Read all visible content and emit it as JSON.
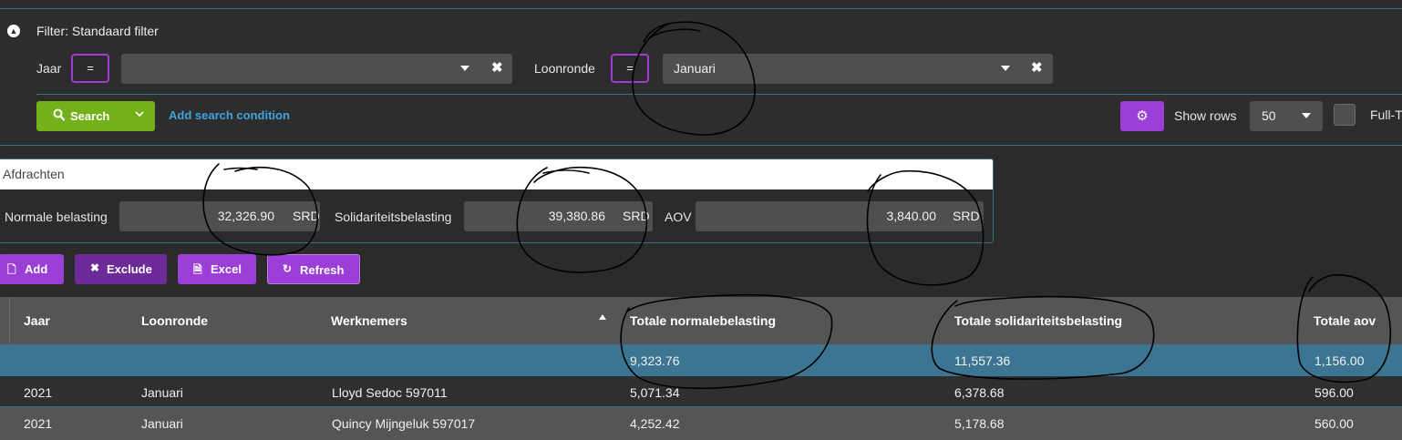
{
  "filter": {
    "title": "Filter: Standaard filter",
    "jaar_label": "Jaar",
    "jaar_operator": "=",
    "jaar_value": "",
    "loonronde_label": "Loonronde",
    "loonronde_operator": "=",
    "loonronde_value": "Januari",
    "search_label": "Search",
    "add_condition_label": "Add search condition",
    "show_rows_label": "Show rows",
    "show_rows_value": "50",
    "fulltext_label": "Full-Te"
  },
  "afdrachten": {
    "title": "Afdrachten",
    "fields": [
      {
        "label": "Normale belasting",
        "value": "32,326.90",
        "unit": "SRD"
      },
      {
        "label": "Solidariteitsbelasting",
        "value": "39,380.86",
        "unit": "SRD"
      },
      {
        "label": "AOV",
        "value": "3,840.00",
        "unit": "SRD"
      }
    ]
  },
  "actions": {
    "add": "Add",
    "exclude": "Exclude",
    "excel": "Excel",
    "refresh": "Refresh"
  },
  "table": {
    "columns": [
      "Jaar",
      "Loonronde",
      "Werknemers",
      "Totale normalebelasting",
      "Totale solidariteitsbelasting",
      "Totale aov"
    ],
    "totals": {
      "normale": "9,323.76",
      "solidariteit": "11,557.36",
      "aov": "1,156.00"
    },
    "rows": [
      [
        "2021",
        "Januari",
        "Lloyd Sedoc 597011",
        "5,071.34",
        "6,378.68",
        "596.00"
      ],
      [
        "2021",
        "Januari",
        "Quincy Mijngeluk 597017",
        "4,252.42",
        "5,178.68",
        "560.00"
      ]
    ]
  },
  "colors": {
    "accent_purple": "#9b3fd6",
    "search_green": "#72b11a",
    "link_blue": "#3fa3dc",
    "totals_row": "#3b7591"
  }
}
